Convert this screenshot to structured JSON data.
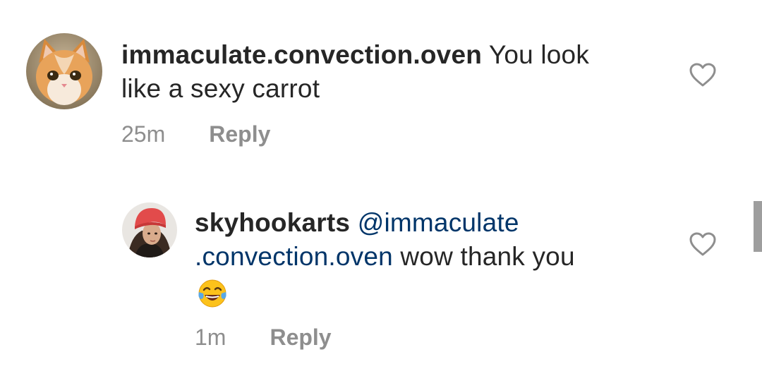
{
  "comments": [
    {
      "username": "immaculate.convection.oven",
      "text_line1": "You look",
      "text_line2": "like a sexy carrot",
      "time": "25m",
      "reply_label": "Reply",
      "avatar_icon": "orange-kitten-avatar",
      "like_icon": "heart-outline-icon"
    },
    {
      "username": "skyhookarts",
      "mention_line1": "@immaculate",
      "mention_line2": ".convection.oven",
      "text_after_mention": "wow thank you",
      "emoji": "face-with-tears-of-joy",
      "time": "1m",
      "reply_label": "Reply",
      "avatar_icon": "woman-red-beanie-avatar",
      "like_icon": "heart-outline-icon"
    }
  ],
  "colors": {
    "text": "#262626",
    "meta": "#8e8e8e",
    "mention": "#003569",
    "scrollbar": "#9e9e9e"
  }
}
